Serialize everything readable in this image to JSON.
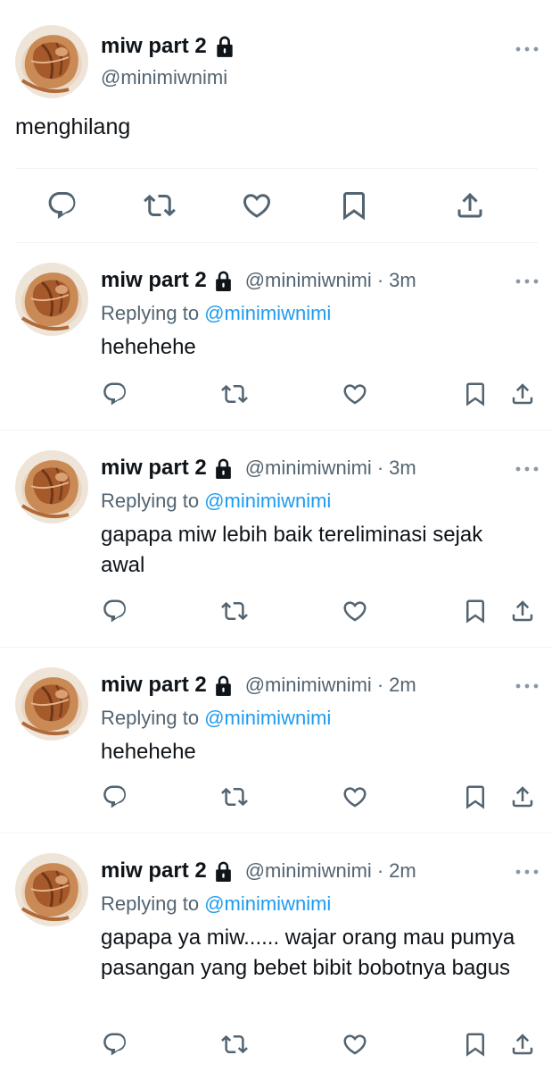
{
  "main_tweet": {
    "display_name": "miw part 2",
    "handle": "@minimiwnimi",
    "text": "menghilang",
    "icons": {
      "avatar": "avatar-photo",
      "lock": "lock-icon",
      "more": "more-icon",
      "reply": "reply-icon",
      "retweet": "retweet-icon",
      "like": "like-icon",
      "bookmark": "bookmark-icon",
      "share": "share-icon"
    }
  },
  "replies": [
    {
      "display_name": "miw part 2",
      "handle": "@minimiwnimi",
      "separator": "·",
      "time": "3m",
      "replying_prefix": "Replying to ",
      "replying_to": "@minimiwnimi",
      "text": "hehehehe"
    },
    {
      "display_name": "miw part 2",
      "handle": "@minimiwnimi",
      "separator": "·",
      "time": "3m",
      "replying_prefix": "Replying to ",
      "replying_to": "@minimiwnimi",
      "text": "gapapa miw lebih baik tereliminasi sejak awal"
    },
    {
      "display_name": "miw part 2",
      "handle": "@minimiwnimi",
      "separator": "·",
      "time": "2m",
      "replying_prefix": "Replying to ",
      "replying_to": "@minimiwnimi",
      "text": "hehehehe"
    },
    {
      "display_name": "miw part 2",
      "handle": "@minimiwnimi",
      "separator": "·",
      "time": "2m",
      "replying_prefix": "Replying to ",
      "replying_to": "@minimiwnimi",
      "text": "gapapa ya miw...... wajar orang mau pumya pasangan yang bebet bibit bobotnya bagus"
    }
  ],
  "colors": {
    "text_primary": "#0f1419",
    "text_secondary": "#536471",
    "mention": "#1d9bf0",
    "divider": "#eff3f4",
    "icon": "#536471"
  }
}
